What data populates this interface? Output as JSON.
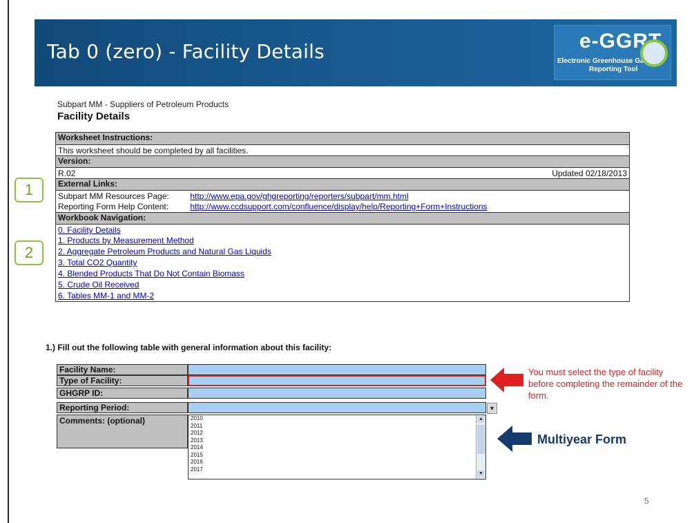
{
  "banner": {
    "title": "Tab 0 (zero) - Facility Details",
    "logo_main": "e-GGRT",
    "logo_sub1": "Electronic Greenhouse Gas",
    "logo_sub2": "Reporting Tool"
  },
  "subtitle": "Subpart MM - Suppliers of Petroleum Products",
  "heading": "Facility Details",
  "info": {
    "instructions_header": "Worksheet Instructions:",
    "instructions_text": "This worksheet should be completed by all facilities.",
    "version_header": "Version:",
    "version_value": "R.02",
    "updated": "Updated 02/18/2013",
    "links_header": "External Links:",
    "links": [
      {
        "label": "Subpart MM Resources Page:",
        "url": "http://www.epa.gov/ghgreporting/reporters/subpart/mm.html"
      },
      {
        "label": "Reporting Form Help Content:",
        "url": "http://www.ccdsupport.com/confluence/display/help/Reporting+Form+Instructions"
      }
    ],
    "nav_header": "Workbook Navigation:",
    "nav": [
      "0. Facility Details",
      "1. Products by Measurement Method",
      "2. Aggregate Petroleum Products and Natural Gas Liquids",
      "3. Total CO2 Quantity",
      "4. Blended Products That Do Not Contain Biomass",
      "5. Crude Oil Received",
      "6. Tables MM-1 and MM-2"
    ]
  },
  "callouts": [
    "1",
    "2"
  ],
  "question": "1.)  Fill out the following table with general information about this facility:",
  "form": {
    "facility_name": "Facility Name:",
    "type_of_facility": "Type of Facility:",
    "ghgrp_id": "GHGRP ID:",
    "reporting_period": "Reporting Period:",
    "comments": "Comments: (optional)",
    "years": [
      "2010",
      "2011",
      "2012",
      "2013",
      "2014",
      "2015",
      "2016",
      "2017"
    ]
  },
  "note": "You must select the type of facility before completing the remainder of the form.",
  "multiyear": "Multiyear Form",
  "page_number": "5",
  "colors": {
    "banner": "#1a5d95",
    "accent_green": "#8bc43f",
    "warning_red": "#e02020",
    "input_blue": "#a9cff0",
    "navy_arrow": "#153a70"
  }
}
